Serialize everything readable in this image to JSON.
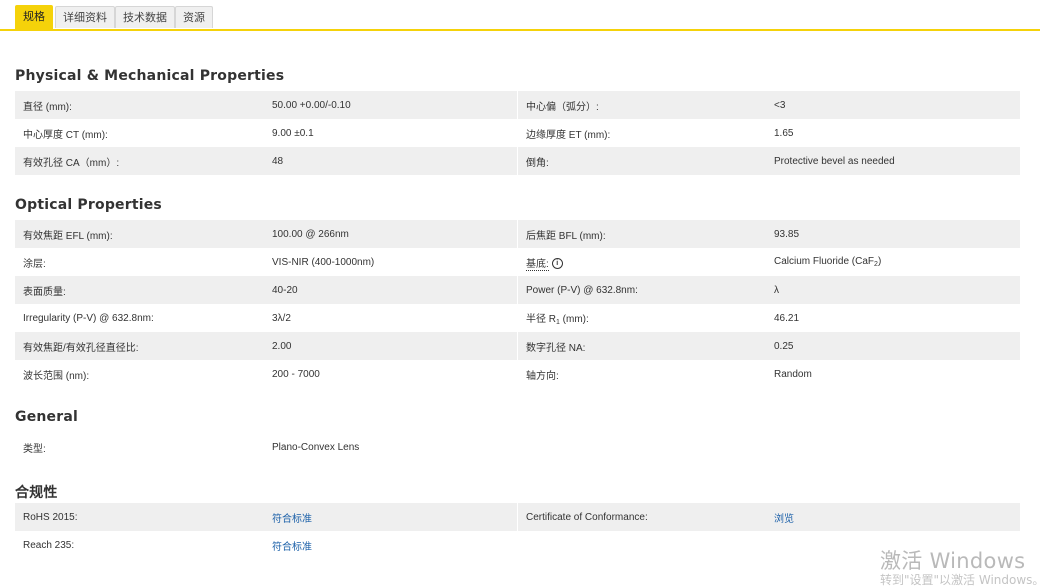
{
  "tabs": [
    {
      "label": "规格",
      "active": true
    },
    {
      "label": "详细资料",
      "active": false
    },
    {
      "label": "技术数据",
      "active": false
    },
    {
      "label": "资源",
      "active": false
    }
  ],
  "sections": {
    "physical": {
      "title": "Physical & Mechanical Properties",
      "rows": [
        {
          "l1": "直径 (mm):",
          "v1": "50.00 +0.00/-0.10",
          "l2": "中心偏（弧分）:",
          "v2": "<3"
        },
        {
          "l1": "中心厚度 CT (mm):",
          "v1": "9.00 ±0.1",
          "l2": "边缘厚度 ET (mm):",
          "v2": "1.65"
        },
        {
          "l1": "有效孔径 CA（mm）:",
          "v1": "48",
          "l2": "倒角:",
          "v2": "Protective bevel as needed"
        }
      ]
    },
    "optical": {
      "title": "Optical Properties",
      "rows": [
        {
          "l1": "有效焦距 EFL (mm):",
          "v1": "100.00 @ 266nm",
          "l2": "后焦距 BFL (mm):",
          "v2": "93.85"
        },
        {
          "l1": "涂层:",
          "v1": "VIS-NIR (400-1000nm)",
          "l2": "基底:",
          "v2_main": "Calcium Fluoride (CaF",
          "v2_sub": "2",
          "v2_end": ")"
        },
        {
          "l1": "表面质量:",
          "v1": "40-20",
          "l2": "Power (P-V) @ 632.8nm:",
          "v2": "λ"
        },
        {
          "l1": "Irregularity (P-V) @ 632.8nm:",
          "v1": "3λ/2",
          "l2_main": "半径 R",
          "l2_sub": "1",
          "l2_end": " (mm):",
          "v2": "46.21"
        },
        {
          "l1": "有效焦距/有效孔径直径比:",
          "v1": "2.00",
          "l2": "数字孔径 NA:",
          "v2": "0.25"
        },
        {
          "l1": "波长范围 (nm):",
          "v1": "200 - 7000",
          "l2": "轴方向:",
          "v2": "Random"
        }
      ]
    },
    "general": {
      "title": "General",
      "rows": [
        {
          "l1": "类型:",
          "v1": "Plano-Convex Lens"
        }
      ]
    },
    "compliance": {
      "title": "合规性",
      "rows": [
        {
          "l1": "RoHS 2015:",
          "v1": "符合标准",
          "l2": "Certificate of Conformance:",
          "v2": "浏览"
        },
        {
          "l1": "Reach 235:",
          "v1": "符合标准"
        }
      ]
    }
  },
  "watermark": {
    "line1": "激活 Windows",
    "line2": "转到\"设置\"以激活 Windows。"
  },
  "colors": {
    "accent": "#f5d20a",
    "row_shade": "#efefef",
    "link": "#1a5fa8"
  },
  "icons": {
    "info": "info-icon"
  }
}
